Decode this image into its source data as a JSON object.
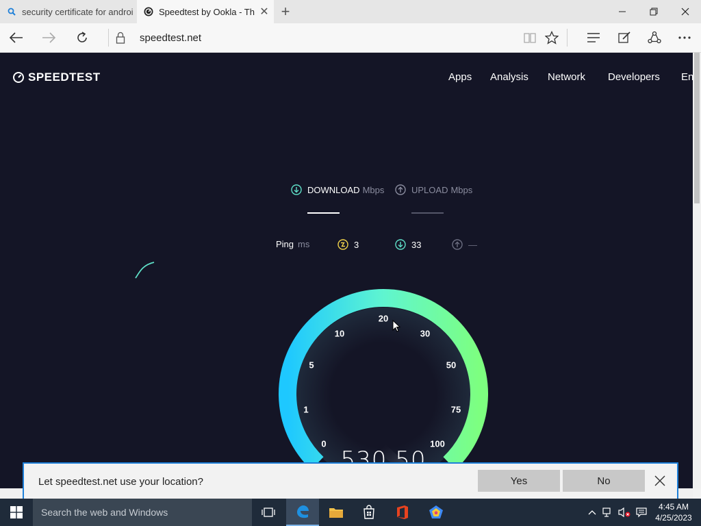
{
  "tabs": [
    {
      "title": "security certificate for androi",
      "favicon": "search-icon"
    },
    {
      "title": "Speedtest by Ookla - Th",
      "favicon": "speedtest-favicon"
    }
  ],
  "address": {
    "url": "speedtest.net"
  },
  "site": {
    "logo": "SPEEDTEST",
    "nav": [
      "Apps",
      "Analysis",
      "Network",
      "Developers",
      "En"
    ]
  },
  "test": {
    "download_label": "DOWNLOAD",
    "download_unit": "Mbps",
    "upload_label": "UPLOAD",
    "upload_unit": "Mbps",
    "ping_label": "Ping",
    "ping_unit": "ms",
    "ping_value": "3",
    "ping_down_value": "33",
    "ping_up_value": "—",
    "gauge_ticks": [
      "0",
      "1",
      "5",
      "10",
      "20",
      "30",
      "50",
      "75",
      "100"
    ],
    "current_speed": "530.50"
  },
  "prompt": {
    "message": "Let speedtest.net use your location?",
    "yes": "Yes",
    "no": "No"
  },
  "taskbar": {
    "search_placeholder": "Search the web and Windows",
    "time": "4:45 AM",
    "date": "4/25/2023"
  },
  "colors": {
    "page_bg": "#141526",
    "accent_cyan": "#1ec8ff",
    "accent_green": "#7dffa0",
    "prompt_border": "#1e7fd8"
  }
}
